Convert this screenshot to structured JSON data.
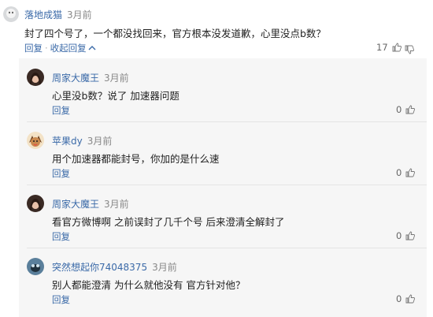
{
  "main_comment": {
    "author": "落地成猫",
    "time": "3月前",
    "text": "封了四个号了，一个都没找回来，官方根本没发道歉，心里没点b数？",
    "reply_label": "回复",
    "separator": "·",
    "collapse_label": "收起回复",
    "collapse_icon": "chevron-up",
    "likes": "17"
  },
  "replies": [
    {
      "author": "周家大魔王",
      "time": "3月前",
      "text": "心里没b数？说了 加速器问题",
      "reply_label": "回复",
      "likes": "0"
    },
    {
      "author": "苹果dy",
      "time": "3月前",
      "text": "用个加速器都能封号，你加的是什么速",
      "reply_label": "回复",
      "likes": "0"
    },
    {
      "author": "周家大魔王",
      "time": "3月前",
      "text": "看官方微博啊 之前误封了几千个号 后来澄清全解封了",
      "reply_label": "回复",
      "likes": "0"
    },
    {
      "author": "突然想起你74048375",
      "time": "3月前",
      "text": "别人都能澄清 为什么就他没有 官方针对他？",
      "reply_label": "回复",
      "likes": "0"
    }
  ],
  "icons": {
    "like": "thumbs-up-icon",
    "dislike": "thumbs-down-icon"
  },
  "colors": {
    "link": "#3b6aa8",
    "reply_background": "#f6f6f6"
  }
}
